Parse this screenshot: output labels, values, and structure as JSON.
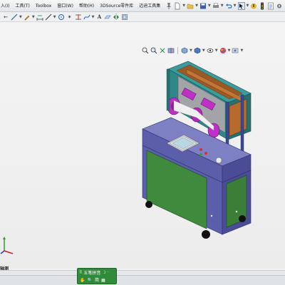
{
  "menu": {
    "items": [
      {
        "name": "menu-insert",
        "label": "入(I)"
      },
      {
        "name": "menu-tools",
        "label": "工具(T)"
      },
      {
        "name": "menu-toolbox",
        "label": "Toolbox"
      },
      {
        "name": "menu-window",
        "label": "窗口(W)"
      },
      {
        "name": "menu-help",
        "label": "帮助(H)"
      },
      {
        "name": "menu-3dsource",
        "label": "3DSource零件库"
      },
      {
        "name": "menu-maidi",
        "label": "迈迪工具集"
      }
    ]
  },
  "view": {
    "orientation_label": "轴测"
  },
  "ime": {
    "label": "五笔拼音",
    "row2": [
      "✋",
      "🔍",
      "简",
      "▦"
    ]
  },
  "colors": {
    "cabinet_body": "#5b5ea8",
    "cabinet_panel": "#3f8a3c",
    "frame": "#2d8c8c",
    "feeder_plate": "#b86a2c",
    "rollers": "#c030c8"
  }
}
